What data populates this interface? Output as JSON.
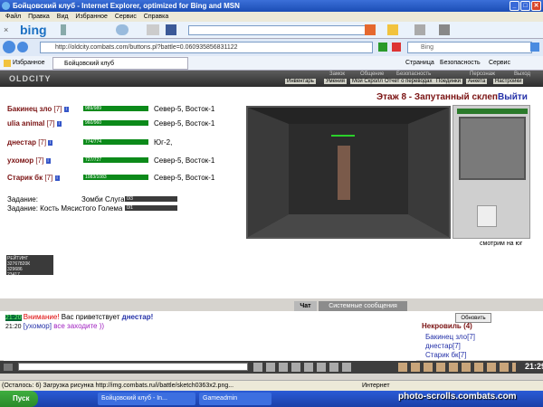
{
  "window": {
    "title": "Бойцовский клуб - Internet Explorer, optimized for Bing and MSN"
  },
  "menu": [
    "Файл",
    "Правка",
    "Вид",
    "Избранное",
    "Сервис",
    "Справка"
  ],
  "bing": {
    "brand": "bing"
  },
  "address": {
    "url": "http://oldcity.combats.com/buttons.pl?battle=0.060935856831122",
    "search_placeholder": "Bing"
  },
  "favorites": {
    "label": "Избранное",
    "tab": "Бойцовский клуб",
    "right_items": [
      "Страница",
      "Безопасность",
      "Сервис"
    ]
  },
  "game": {
    "logo": "OLDCITY",
    "nav_top": [
      "Замок",
      "Общение",
      "Безопасность",
      "Персонаж",
      "Выход"
    ],
    "nav_bottom": [
      "Инвентарь",
      "Умения",
      "Мой Скролл",
      "Отчет о переводах",
      "Поединки",
      "Анкета",
      "Настройки"
    ],
    "floor": "Этаж 8 - Запутанный склеп",
    "exit": "Выйти",
    "players": [
      {
        "name": "Бакинец зло",
        "level": "[7]",
        "hp": "989/989",
        "loc": "Север-5, Восток-1"
      },
      {
        "name": "ulia animal",
        "level": "[7]",
        "hp": "960/960",
        "loc": "Север-5, Восток-1"
      },
      {
        "name": "днестар",
        "level": "[7]",
        "hp": "774/774",
        "loc": "Юг-2,"
      },
      {
        "name": "ухомор",
        "level": "[7]",
        "hp": "727/727",
        "loc": "Север-5, Восток-1"
      },
      {
        "name": "Старик бк",
        "level": "[7]",
        "hp": "1083/1083",
        "loc": "Север-5, Восток-1"
      }
    ],
    "tasks": [
      {
        "label": "Задание:",
        "target": "Зомби Слуга",
        "count": "0/3"
      },
      {
        "label": "Задание: Кость Мясистого Голема",
        "count": "0/1"
      }
    ],
    "look_dir": "смотрим на юг",
    "rating": {
      "title": "РЕЙТИНГ",
      "v1": "32767820К",
      "v2": "329686",
      "v3": "23417"
    }
  },
  "chat": {
    "tab_chat": "Чат",
    "tab_system": "Системные сообщения",
    "lines": [
      {
        "time": "21:20",
        "warn": "Внимание!",
        "text": "Вас приветствует",
        "who": "днестар!"
      },
      {
        "time": "21:20",
        "user": "[ухомор]",
        "text": "все заходите ))"
      }
    ],
    "refresh": "Обновить",
    "room": "Некровиль (4)",
    "members": [
      "Бакинец зло[7]",
      "днестар[7]",
      "Старик бк[7]"
    ]
  },
  "toolbar": {
    "clock": "21:29"
  },
  "status": {
    "text": "(Осталось: 6) Загрузка рисунка http://img.combats.ru/i/battle/sketch0363x2.png...",
    "zone": "Интернет"
  },
  "taskbar": {
    "start": "Пуск",
    "items": [
      "Бойцовский клуб - In...",
      "Gameadmin"
    ],
    "watermark": "photo-scrolls.combats.com"
  }
}
